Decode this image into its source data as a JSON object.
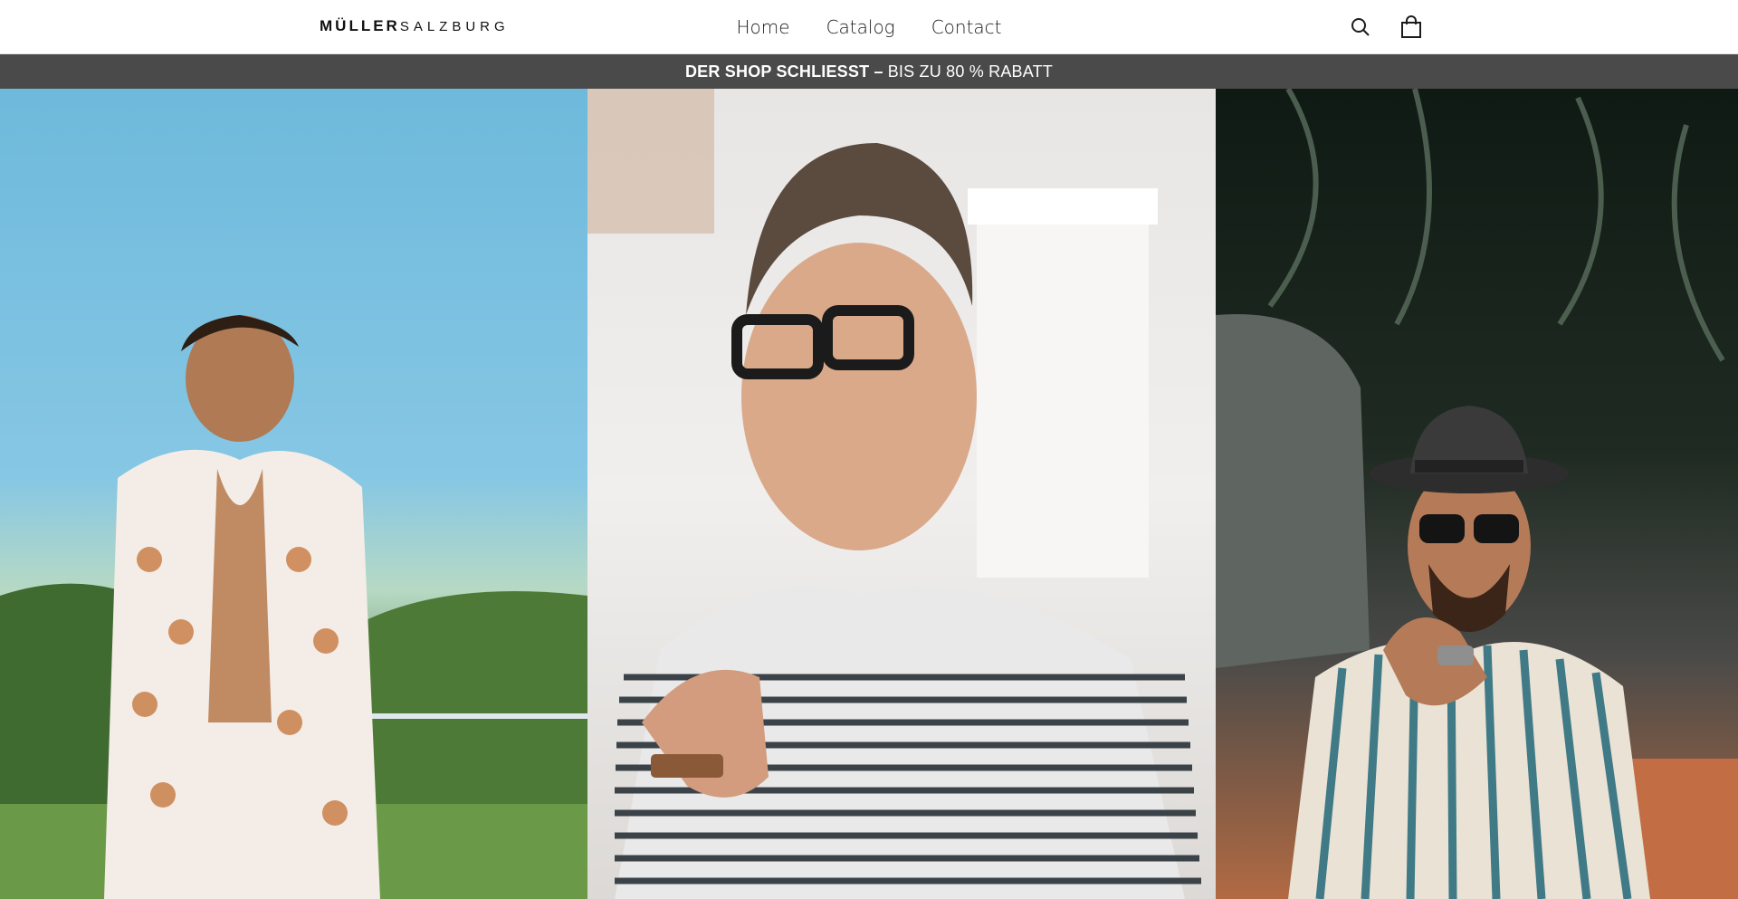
{
  "brand": {
    "name_bold": "MÜLLER",
    "name_light": "SALZBURG"
  },
  "nav": {
    "items": [
      {
        "label": "Home"
      },
      {
        "label": "Catalog"
      },
      {
        "label": "Contact"
      }
    ]
  },
  "header_icons": {
    "search": "search-icon",
    "cart": "shopping-bag-icon"
  },
  "announcement": {
    "strong": "DER SHOP SCHLIESST –",
    "normal": "BIS ZU 80 % RABATT",
    "background": "#4a4a4a"
  },
  "hero": {
    "panels": [
      {
        "subject": "man in floral shirt on terrace"
      },
      {
        "subject": "man with glasses in striped t-shirt"
      },
      {
        "subject": "man in hat and striped shirt"
      }
    ]
  }
}
